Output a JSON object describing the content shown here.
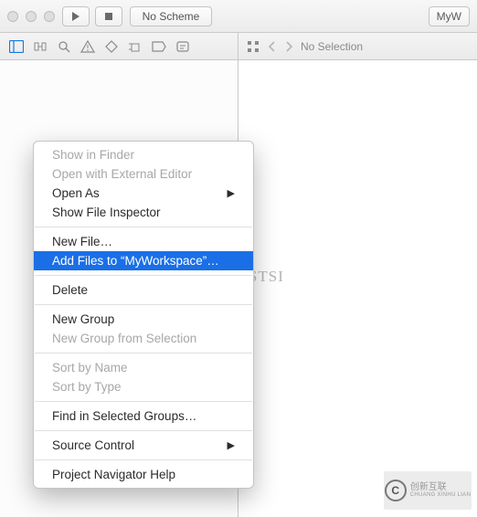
{
  "toolbar": {
    "scheme_label": "No Scheme",
    "right_label": "MyW"
  },
  "nav": {
    "no_selection": "No Selection"
  },
  "watermark": "https://blog.csdn.net/PRESISTSI",
  "logo": {
    "letter": "C",
    "line1": "创新互联",
    "line2": "CHUANG XINHU LIAN"
  },
  "context_menu": {
    "show_in_finder": "Show in Finder",
    "open_external": "Open with External Editor",
    "open_as": "Open As",
    "show_inspector": "Show File Inspector",
    "new_file": "New File…",
    "add_files": "Add Files to “MyWorkspace”…",
    "delete": "Delete",
    "new_group": "New Group",
    "new_group_sel": "New Group from Selection",
    "sort_name": "Sort by Name",
    "sort_type": "Sort by Type",
    "find_groups": "Find in Selected Groups…",
    "source_control": "Source Control",
    "project_help": "Project Navigator Help"
  }
}
